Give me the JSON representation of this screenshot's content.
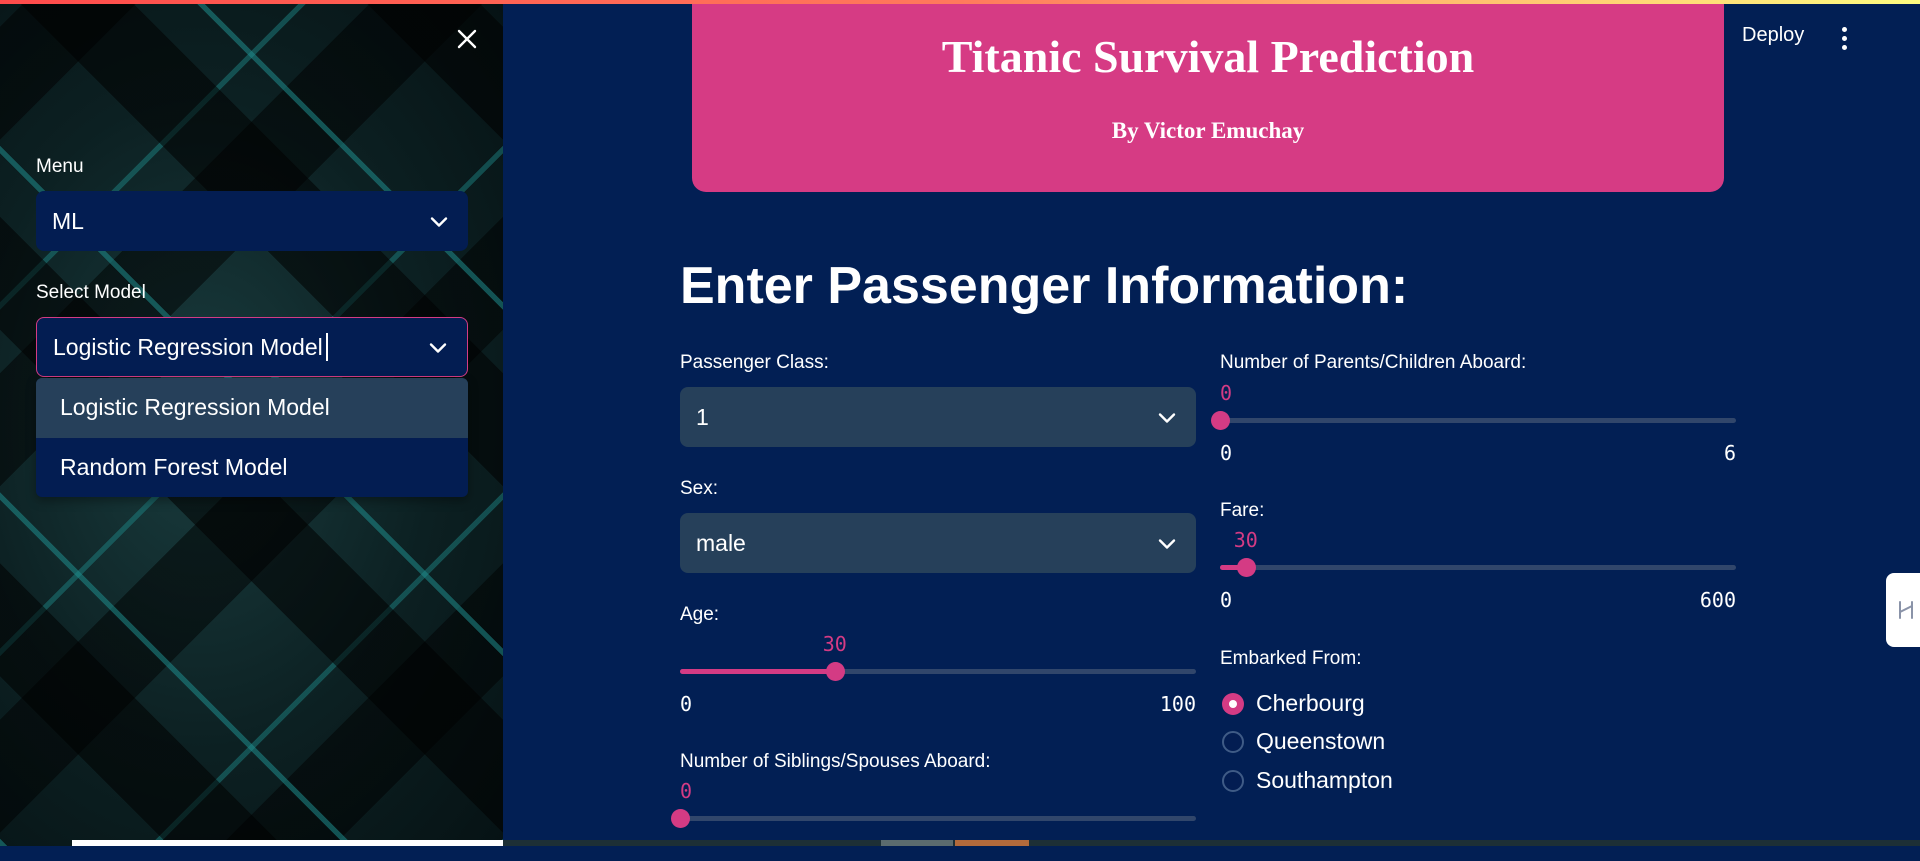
{
  "sidebar": {
    "menu_label": "Menu",
    "menu_value": "ML",
    "model_label": "Select Model",
    "model_input_value": "Logistic Regression Model",
    "model_options": [
      "Logistic Regression Model",
      "Random Forest Model"
    ]
  },
  "header": {
    "deploy_label": "Deploy"
  },
  "banner": {
    "title": "Titanic Survival Prediction",
    "byline": "By Victor Emuchay"
  },
  "form": {
    "title": "Enter Passenger Information:",
    "pclass": {
      "label": "Passenger Class:",
      "value": "1"
    },
    "sex": {
      "label": "Sex:",
      "value": "male"
    },
    "age": {
      "label": "Age:",
      "value": "30",
      "min": "0",
      "max": "100",
      "fraction": 0.3
    },
    "sibsp": {
      "label": "Number of Siblings/Spouses Aboard:",
      "value": "0",
      "fraction": 0
    },
    "parch": {
      "label": "Number of Parents/Children Aboard:",
      "value": "0",
      "min": "0",
      "max": "6",
      "fraction": 0
    },
    "fare": {
      "label": "Fare:",
      "value": "30",
      "min": "0",
      "max": "600",
      "fraction": 0.05
    },
    "embarked": {
      "label": "Embarked From:",
      "options": [
        "Cherbourg",
        "Queenstown",
        "Southampton"
      ],
      "selected": "Cherbourg"
    }
  },
  "colors": {
    "background": "#021f54",
    "accent": "#d43b84",
    "banner": "#d63b84",
    "input_bg": "#26405a"
  },
  "icons": [
    "close-icon",
    "chevron-down-icon",
    "kebab-menu-icon",
    "sidebar-handle-icon"
  ]
}
